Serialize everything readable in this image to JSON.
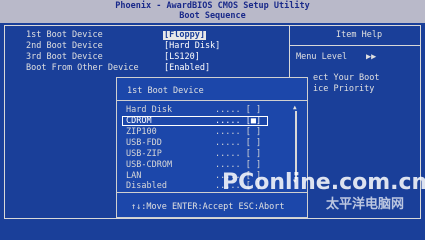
{
  "header": {
    "title": "Phoenix - AwardBIOS CMOS Setup Utility",
    "subtitle": "Boot Sequence"
  },
  "settings": [
    {
      "label": "1st Boot Device",
      "value": "[Floppy]"
    },
    {
      "label": "2nd Boot Device",
      "value": "[Hard Disk]"
    },
    {
      "label": "3rd Boot Device",
      "value": "[LS120]"
    },
    {
      "label": "Boot From Other Device",
      "value": "[Enabled]"
    }
  ],
  "help": {
    "title": "Item Help",
    "menu_level": "Menu Level",
    "menu_level_arrows": "▶▶",
    "line1": "ect Your Boot",
    "line2": "ice Priority"
  },
  "popup": {
    "title": "1st Boot Device",
    "options": [
      {
        "label": "Hard Disk",
        "mark": "..... [ ]"
      },
      {
        "label": "CDROM",
        "mark": "..... [■]"
      },
      {
        "label": "ZIP100",
        "mark": "..... [ ]"
      },
      {
        "label": "USB-FDD",
        "mark": "..... [ ]"
      },
      {
        "label": "USB-ZIP",
        "mark": "..... [ ]"
      },
      {
        "label": "USB-CDROM",
        "mark": "..... [ ]"
      },
      {
        "label": "LAN",
        "mark": "..... [ ]"
      },
      {
        "label": "Disabled",
        "mark": "..... [ ]"
      }
    ],
    "footer": "↑↓:Move ENTER:Accept ESC:Abort"
  },
  "watermark": {
    "main": "PConline.com.cn",
    "sub": "太平洋电脑网"
  },
  "colors": {
    "background": "#1a3f99",
    "title_bar": "#b9b9c9",
    "popup": "#1c47aa",
    "text": "#e0e0e0"
  }
}
